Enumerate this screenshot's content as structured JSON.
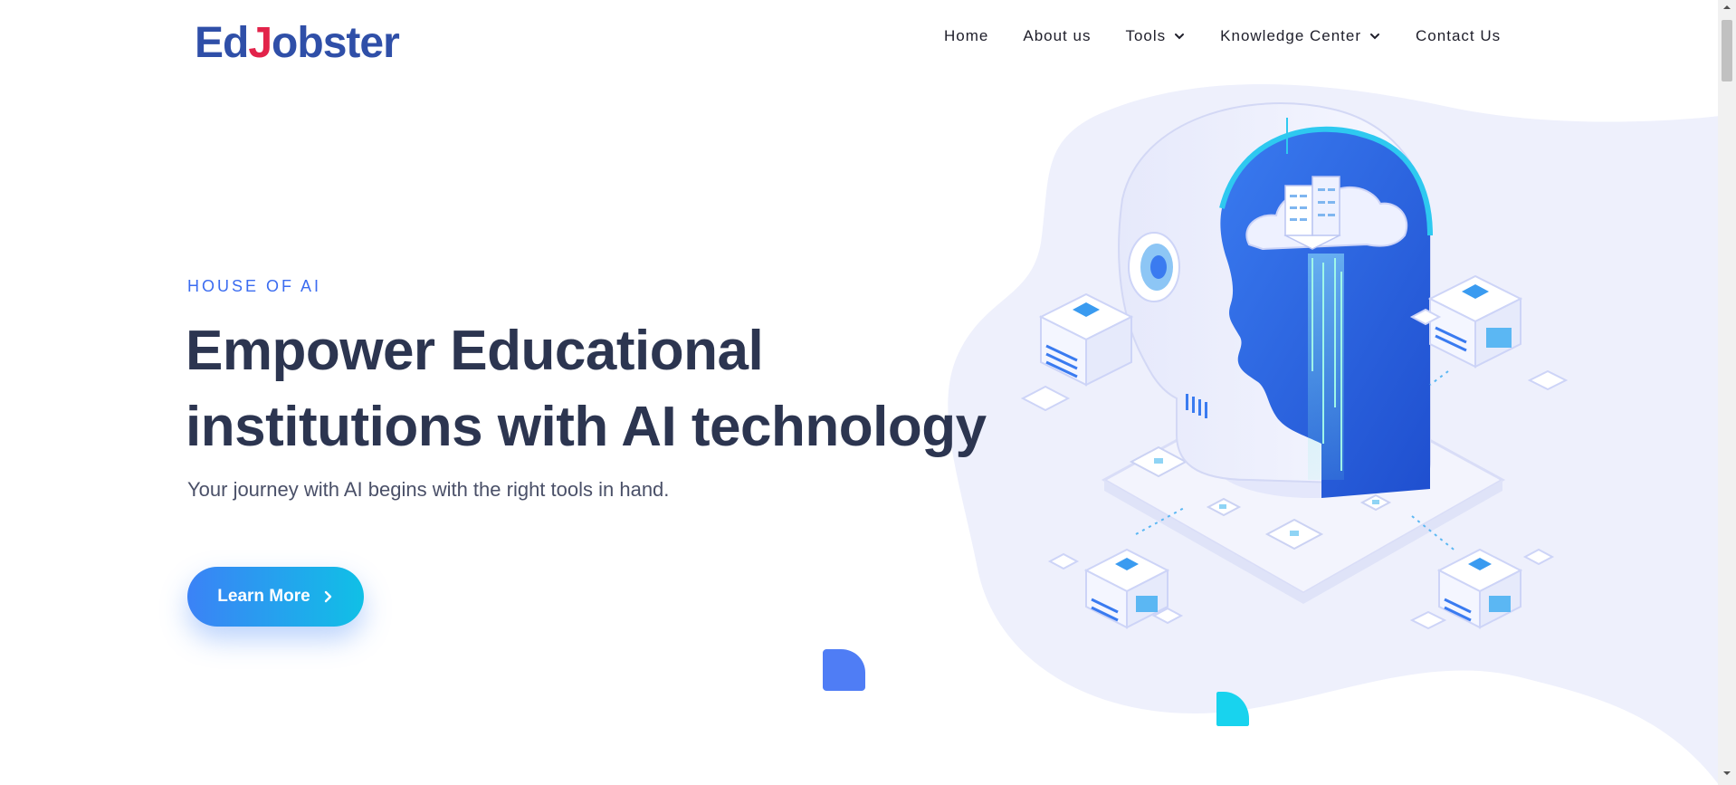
{
  "logo": {
    "part1": "Ed",
    "part2": "J",
    "part3": "obster"
  },
  "nav": {
    "home": "Home",
    "about": "About us",
    "tools": "Tools",
    "knowledge": "Knowledge Center",
    "contact": "Contact Us"
  },
  "hero": {
    "eyebrow": "HOUSE OF AI",
    "headline_line1": "Empower Educational",
    "headline_line2": "institutions with AI technology",
    "subtitle": "Your journey with AI begins with the right tools in hand.",
    "cta_label": "Learn More"
  },
  "colors": {
    "brand_blue": "#2f4fa8",
    "brand_red": "#e2234a",
    "accent": "#3b6cf0",
    "cta_gradient_start": "#3b82f6",
    "cta_gradient_end": "#10c0e6",
    "heading": "#2c3550"
  }
}
